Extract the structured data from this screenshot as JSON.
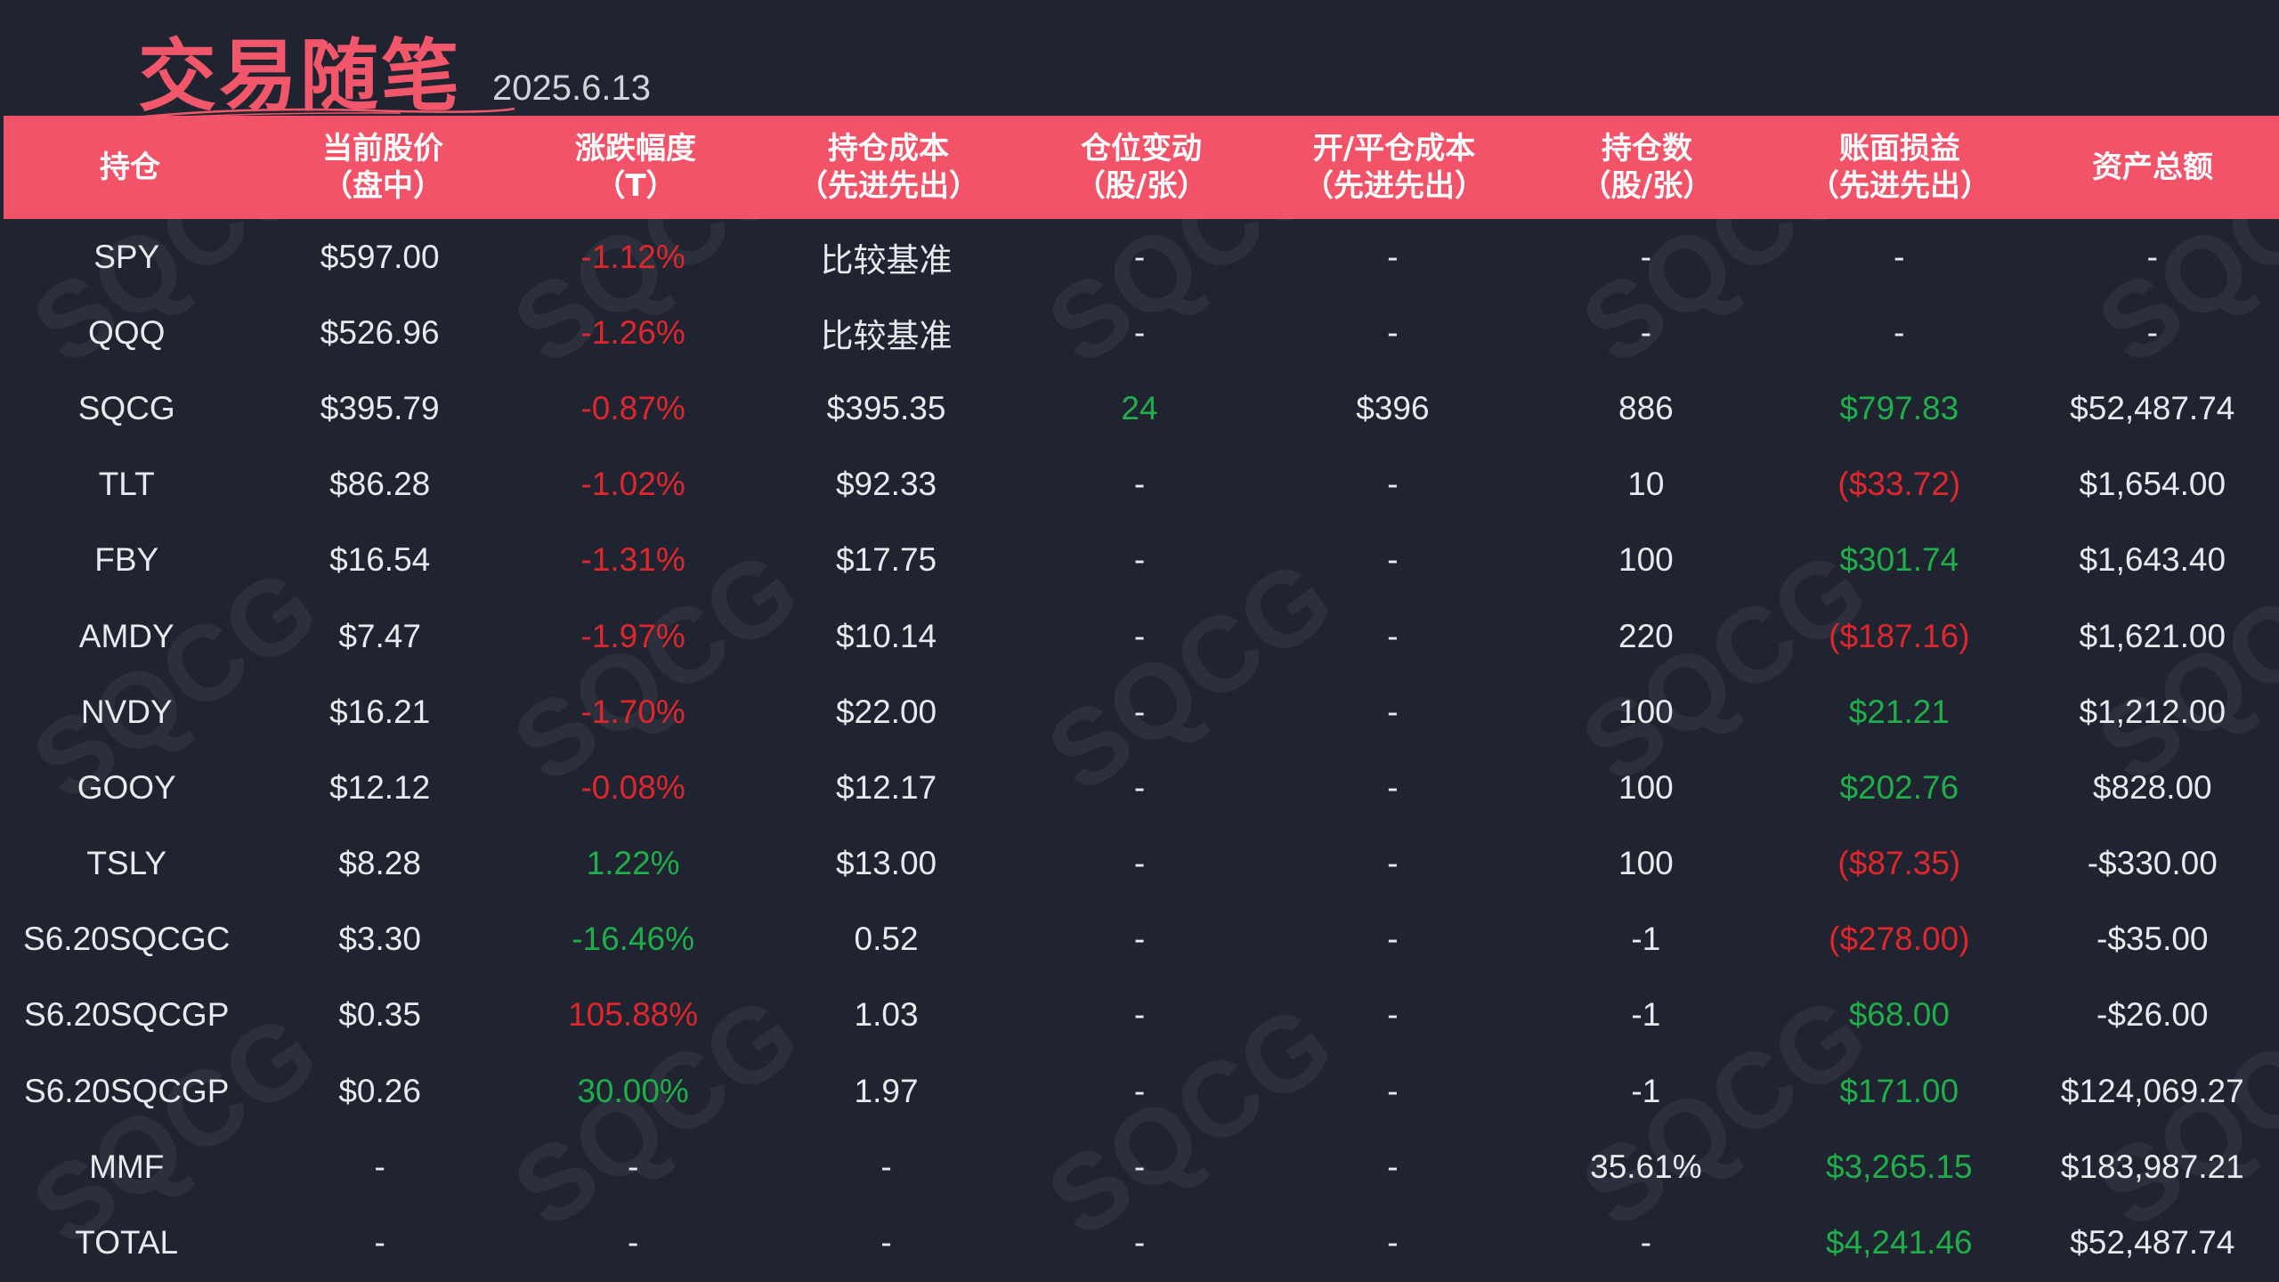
{
  "title": "交易随笔",
  "date": "2025.6.13",
  "watermark_text": "SQCG",
  "colors": {
    "background": "#1f2430",
    "header_bg": "#f25368",
    "title": "#f2566b",
    "up": "#1fae4a",
    "down": "#e0262d",
    "text": "#e8eaee"
  },
  "headers": [
    {
      "line1": "持仓",
      "line2": ""
    },
    {
      "line1": "当前股价",
      "line2": "（盘中）"
    },
    {
      "line1": "涨跌幅度",
      "line2": "（T）"
    },
    {
      "line1": "持仓成本",
      "line2": "（先进先出）"
    },
    {
      "line1": "仓位变动",
      "line2": "（股/张）"
    },
    {
      "line1": "开/平仓成本",
      "line2": "（先进先出）"
    },
    {
      "line1": "持仓数",
      "line2": "（股/张）"
    },
    {
      "line1": "账面损益",
      "line2": "（先进先出）"
    },
    {
      "line1": "资产总额",
      "line2": ""
    }
  ],
  "rows": [
    {
      "symbol": "SPY",
      "price": "$597.00",
      "change": "-1.12%",
      "change_color": "red",
      "cost": "比较基准",
      "pos_change": "-",
      "pos_change_color": "",
      "open_cost": "-",
      "qty": "-",
      "pnl": "-",
      "pnl_color": "",
      "total": "-"
    },
    {
      "symbol": "QQQ",
      "price": "$526.96",
      "change": "-1.26%",
      "change_color": "red",
      "cost": "比较基准",
      "pos_change": "-",
      "pos_change_color": "",
      "open_cost": "-",
      "qty": "-",
      "pnl": "-",
      "pnl_color": "",
      "total": "-"
    },
    {
      "symbol": "SQCG",
      "price": "$395.79",
      "change": "-0.87%",
      "change_color": "red",
      "cost": "$395.35",
      "pos_change": "24",
      "pos_change_color": "green",
      "open_cost": "$396",
      "qty": "886",
      "pnl": "$797.83",
      "pnl_color": "green",
      "total": "$52,487.74"
    },
    {
      "symbol": "TLT",
      "price": "$86.28",
      "change": "-1.02%",
      "change_color": "red",
      "cost": "$92.33",
      "pos_change": "-",
      "pos_change_color": "",
      "open_cost": "-",
      "qty": "10",
      "pnl": "($33.72)",
      "pnl_color": "red",
      "total": "$1,654.00"
    },
    {
      "symbol": "FBY",
      "price": "$16.54",
      "change": "-1.31%",
      "change_color": "red",
      "cost": "$17.75",
      "pos_change": "-",
      "pos_change_color": "",
      "open_cost": "-",
      "qty": "100",
      "pnl": "$301.74",
      "pnl_color": "green",
      "total": "$1,643.40"
    },
    {
      "symbol": "AMDY",
      "price": "$7.47",
      "change": "-1.97%",
      "change_color": "red",
      "cost": "$10.14",
      "pos_change": "-",
      "pos_change_color": "",
      "open_cost": "-",
      "qty": "220",
      "pnl": "($187.16)",
      "pnl_color": "red",
      "total": "$1,621.00"
    },
    {
      "symbol": "NVDY",
      "price": "$16.21",
      "change": "-1.70%",
      "change_color": "red",
      "cost": "$22.00",
      "pos_change": "-",
      "pos_change_color": "",
      "open_cost": "-",
      "qty": "100",
      "pnl": "$21.21",
      "pnl_color": "green",
      "total": "$1,212.00"
    },
    {
      "symbol": "GOOY",
      "price": "$12.12",
      "change": "-0.08%",
      "change_color": "red",
      "cost": "$12.17",
      "pos_change": "-",
      "pos_change_color": "",
      "open_cost": "-",
      "qty": "100",
      "pnl": "$202.76",
      "pnl_color": "green",
      "total": "$828.00"
    },
    {
      "symbol": "TSLY",
      "price": "$8.28",
      "change": "1.22%",
      "change_color": "green",
      "cost": "$13.00",
      "pos_change": "-",
      "pos_change_color": "",
      "open_cost": "-",
      "qty": "100",
      "pnl": "($87.35)",
      "pnl_color": "red",
      "total": "-$330.00"
    },
    {
      "symbol": "S6.20SQCGC",
      "price": "$3.30",
      "change": "-16.46%",
      "change_color": "green",
      "cost": "0.52",
      "pos_change": "-",
      "pos_change_color": "",
      "open_cost": "-",
      "qty": "-1",
      "pnl": "($278.00)",
      "pnl_color": "red",
      "total": "-$35.00"
    },
    {
      "symbol": "S6.20SQCGP",
      "price": "$0.35",
      "change": "105.88%",
      "change_color": "red",
      "cost": "1.03",
      "pos_change": "-",
      "pos_change_color": "",
      "open_cost": "-",
      "qty": "-1",
      "pnl": "$68.00",
      "pnl_color": "green",
      "total": "-$26.00"
    },
    {
      "symbol": "S6.20SQCGP",
      "price": "$0.26",
      "change": "30.00%",
      "change_color": "green",
      "cost": "1.97",
      "pos_change": "-",
      "pos_change_color": "",
      "open_cost": "-",
      "qty": "-1",
      "pnl": "$171.00",
      "pnl_color": "green",
      "total": "$124,069.27"
    },
    {
      "symbol": "MMF",
      "price": "-",
      "change": "-",
      "change_color": "",
      "cost": "-",
      "pos_change": "-",
      "pos_change_color": "",
      "open_cost": "-",
      "qty": "35.61%",
      "pnl": "$3,265.15",
      "pnl_color": "green",
      "total": "$183,987.21"
    },
    {
      "symbol": "TOTAL",
      "price": "-",
      "change": "-",
      "change_color": "",
      "cost": "-",
      "pos_change": "-",
      "pos_change_color": "",
      "open_cost": "-",
      "qty": "-",
      "pnl": "$4,241.46",
      "pnl_color": "green",
      "total": "$52,487.74"
    }
  ]
}
